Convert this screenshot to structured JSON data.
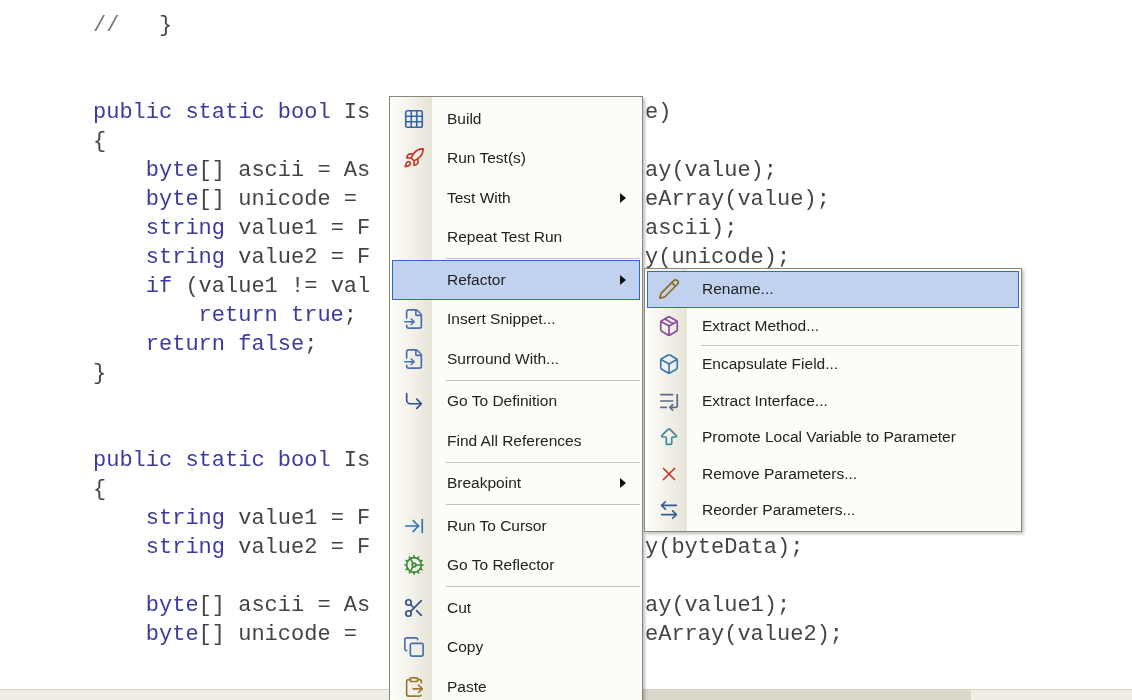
{
  "editor": {
    "lines": [
      {
        "kind": "code",
        "segments": [
          {
            "text": "//",
            "kind": "comment"
          },
          {
            "text": "   }",
            "kind": "plain"
          }
        ]
      },
      {
        "kind": "blank"
      },
      {
        "kind": "blank"
      },
      {
        "kind": "code",
        "segments": [
          {
            "text": "public static bool",
            "kind": "keyword"
          },
          {
            "text": " Is",
            "kind": "plain"
          }
        ],
        "right": "e)"
      },
      {
        "kind": "code",
        "segments": [
          {
            "text": "{",
            "kind": "plain"
          }
        ],
        "children": [
          {
            "kind": "code",
            "segments": [
              {
                "text": "byte",
                "kind": "keyword"
              },
              {
                "text": "[] ascii = As",
                "kind": "plain"
              }
            ],
            "right": "ay(value);"
          },
          {
            "kind": "code",
            "segments": [
              {
                "text": "byte",
                "kind": "keyword"
              },
              {
                "text": "[] unicode = ",
                "kind": "plain"
              }
            ],
            "right": "eArray(value);"
          },
          {
            "kind": "code",
            "segments": [
              {
                "text": "string",
                "kind": "keyword"
              },
              {
                "text": " value1 = F",
                "kind": "plain"
              }
            ],
            "right": "ascii);"
          },
          {
            "kind": "code",
            "segments": [
              {
                "text": "string",
                "kind": "keyword"
              },
              {
                "text": " value2 = F",
                "kind": "plain"
              }
            ],
            "right": "y(unicode);"
          },
          {
            "kind": "code",
            "segments": [
              {
                "text": "if",
                "kind": "keyword"
              },
              {
                "text": " (value1 != val",
                "kind": "plain"
              }
            ],
            "children": [
              {
                "kind": "code",
                "segments": [
                  {
                    "text": "return true",
                    "kind": "keyword"
                  },
                  {
                    "text": ";",
                    "kind": "plain"
                  }
                ]
              }
            ]
          },
          {
            "kind": "code",
            "segments": [
              {
                "text": "return false",
                "kind": "keyword"
              },
              {
                "text": ";",
                "kind": "plain"
              }
            ]
          }
        ]
      },
      {
        "kind": "code",
        "segments": [
          {
            "text": "}",
            "kind": "plain"
          }
        ]
      },
      {
        "kind": "blank"
      },
      {
        "kind": "blank"
      },
      {
        "kind": "code",
        "segments": [
          {
            "text": "public static bool",
            "kind": "keyword"
          },
          {
            "text": " Is",
            "kind": "plain"
          }
        ]
      },
      {
        "kind": "code",
        "segments": [
          {
            "text": "{",
            "kind": "plain"
          }
        ],
        "children": [
          {
            "kind": "code",
            "segments": [
              {
                "text": "string",
                "kind": "keyword"
              },
              {
                "text": " value1 = F",
                "kind": "plain"
              }
            ]
          },
          {
            "kind": "code",
            "segments": [
              {
                "text": "string",
                "kind": "keyword"
              },
              {
                "text": " value2 = F",
                "kind": "plain"
              }
            ],
            "right": "y(byteData);"
          },
          {
            "kind": "blank"
          },
          {
            "kind": "code",
            "segments": [
              {
                "text": "byte",
                "kind": "keyword"
              },
              {
                "text": "[] ascii = As",
                "kind": "plain"
              }
            ],
            "right": "ay(value1);"
          },
          {
            "kind": "code",
            "segments": [
              {
                "text": "byte",
                "kind": "keyword"
              },
              {
                "text": "[] unicode = ",
                "kind": "plain"
              }
            ],
            "right": "eArray(value2);"
          }
        ]
      }
    ]
  },
  "context_menu": {
    "items": [
      {
        "kind": "item",
        "label": "Build",
        "selected": false
      },
      {
        "kind": "item",
        "label": "Run Test(s)",
        "selected": false
      },
      {
        "kind": "submenu",
        "label": "Test With",
        "selected": false
      },
      {
        "kind": "item",
        "label": "Repeat Test Run",
        "selected": false
      },
      {
        "kind": "separator"
      },
      {
        "kind": "submenu",
        "label": "Refactor",
        "selected": true,
        "submenu": {
          "items": [
            {
              "kind": "item",
              "label": "Rename...",
              "selected": true
            },
            {
              "kind": "item",
              "label": "Extract Method...",
              "selected": false
            },
            {
              "kind": "separator"
            },
            {
              "kind": "item",
              "label": "Encapsulate Field...",
              "selected": false
            },
            {
              "kind": "item",
              "label": "Extract Interface...",
              "selected": false
            },
            {
              "kind": "item",
              "label": "Promote Local Variable to Parameter",
              "selected": false
            },
            {
              "kind": "item",
              "label": "Remove Parameters...",
              "selected": false
            },
            {
              "kind": "item",
              "label": "Reorder Parameters...",
              "selected": false
            }
          ]
        }
      },
      {
        "kind": "item",
        "label": "Insert Snippet...",
        "selected": false
      },
      {
        "kind": "item",
        "label": "Surround With...",
        "selected": false
      },
      {
        "kind": "separator"
      },
      {
        "kind": "item",
        "label": "Go To Definition",
        "selected": false
      },
      {
        "kind": "item",
        "label": "Find All References",
        "selected": false
      },
      {
        "kind": "separator"
      },
      {
        "kind": "submenu",
        "label": "Breakpoint",
        "selected": false
      },
      {
        "kind": "separator"
      },
      {
        "kind": "item",
        "label": "Run To Cursor",
        "selected": false
      },
      {
        "kind": "item",
        "label": "Go To Reflector",
        "selected": false
      },
      {
        "kind": "separator"
      },
      {
        "kind": "item",
        "label": "Cut",
        "selected": false
      },
      {
        "kind": "item",
        "label": "Copy",
        "selected": false
      },
      {
        "kind": "item",
        "label": "Paste",
        "selected": false
      }
    ]
  }
}
